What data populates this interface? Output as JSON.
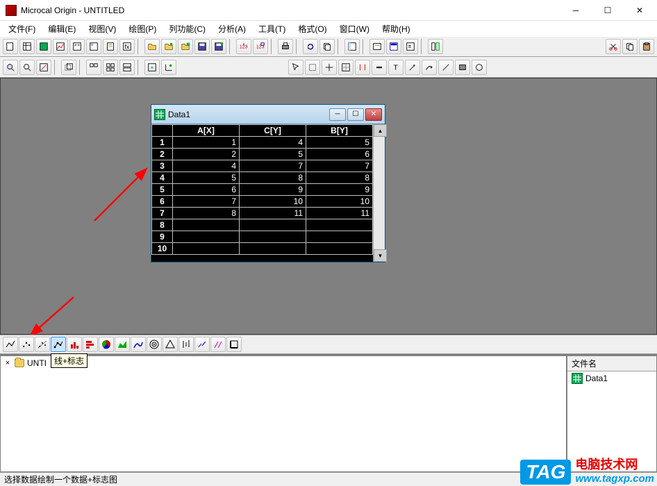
{
  "title": "Microcal Origin - UNTITLED",
  "menu": [
    "文件(F)",
    "编辑(E)",
    "视图(V)",
    "绘图(P)",
    "列功能(C)",
    "分析(A)",
    "工具(T)",
    "格式(O)",
    "窗口(W)",
    "帮助(H)"
  ],
  "child": {
    "title": "Data1"
  },
  "columns": [
    "A[X]",
    "C[Y]",
    "B[Y]"
  ],
  "rows": [
    {
      "n": "1",
      "a": "1",
      "c": "4",
      "b": "5"
    },
    {
      "n": "2",
      "a": "2",
      "c": "5",
      "b": "6"
    },
    {
      "n": "3",
      "a": "4",
      "c": "7",
      "b": "7"
    },
    {
      "n": "4",
      "a": "5",
      "c": "8",
      "b": "8"
    },
    {
      "n": "5",
      "a": "6",
      "c": "9",
      "b": "9"
    },
    {
      "n": "6",
      "a": "7",
      "c": "10",
      "b": "10"
    },
    {
      "n": "7",
      "a": "8",
      "c": "11",
      "b": "11"
    },
    {
      "n": "8",
      "a": "",
      "c": "",
      "b": ""
    },
    {
      "n": "9",
      "a": "",
      "c": "",
      "b": ""
    },
    {
      "n": "10",
      "a": "",
      "c": "",
      "b": ""
    }
  ],
  "tooltip": "线+标志",
  "project_root": "UNTI",
  "filepanel_hdr": "文件名",
  "file_item": "Data1",
  "status": "选择数据绘制一个数据+标志图",
  "tag": {
    "box": "TAG",
    "cn": "电脑技术网",
    "url": "www.tagxp.com"
  },
  "chart_data": {
    "type": "table",
    "columns": [
      "A[X]",
      "C[Y]",
      "B[Y]"
    ],
    "data": [
      [
        1,
        4,
        5
      ],
      [
        2,
        5,
        6
      ],
      [
        4,
        7,
        7
      ],
      [
        5,
        8,
        8
      ],
      [
        6,
        9,
        9
      ],
      [
        7,
        10,
        10
      ],
      [
        8,
        11,
        11
      ]
    ]
  }
}
